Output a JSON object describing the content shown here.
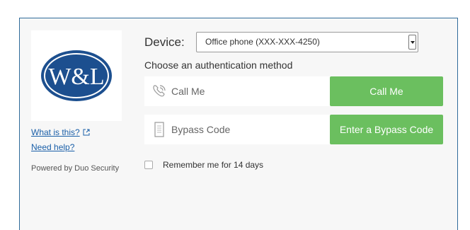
{
  "sidebar": {
    "logo_text": "W&L",
    "what_is_this": "What is this?",
    "need_help": "Need help?",
    "powered_by": "Powered by Duo Security"
  },
  "device": {
    "label": "Device:",
    "selected": "Office phone (XXX-XXX-4250)"
  },
  "auth": {
    "prompt": "Choose an authentication method",
    "methods": [
      {
        "label": "Call Me",
        "button": "Call Me",
        "icon": "phone-icon"
      },
      {
        "label": "Bypass Code",
        "button": "Enter a Bypass Code",
        "icon": "bypass-code-icon"
      }
    ]
  },
  "remember": {
    "label": "Remember me for 14 days",
    "checked": false
  },
  "colors": {
    "accent_green": "#6bbf5f",
    "link_blue": "#1a5fa8",
    "frame_border": "#2f6b9a",
    "logo_blue": "#1c4f8f"
  }
}
